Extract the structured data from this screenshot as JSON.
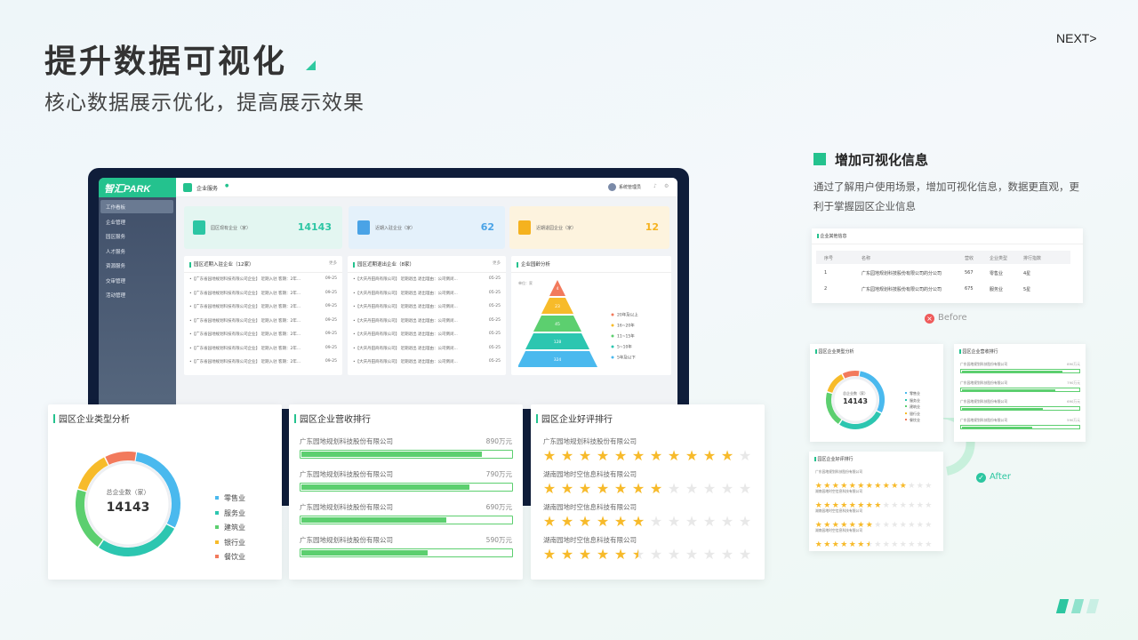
{
  "page": {
    "title": "提升数据可视化",
    "subtitle": "核心数据展示优化，提高展示效果",
    "next": "NEXT>"
  },
  "laptop": {
    "logo": "智汇PARK",
    "tab": "企业服务",
    "user": "系统管理员",
    "nav": [
      {
        "label": "工作看板",
        "active": true
      },
      {
        "label": "企业管理"
      },
      {
        "label": "园区服务"
      },
      {
        "label": "人才服务"
      },
      {
        "label": "资源服务"
      },
      {
        "label": "交审管理"
      },
      {
        "label": "活动管理"
      }
    ],
    "stats": [
      {
        "label": "园区现有企业（家）",
        "value": "14143",
        "color": "#2cc6a4",
        "bg": "#e3f6f1"
      },
      {
        "label": "近期入驻企业（家）",
        "value": "62",
        "color": "#4aa3e6",
        "bg": "#e4f1fb"
      },
      {
        "label": "近期退园企业（家）",
        "value": "12",
        "color": "#f5b21f",
        "bg": "#fdf3de"
      }
    ],
    "panel_in": {
      "title": "园区近期入驻企业（12家）",
      "more": "更多",
      "rows": [
        {
          "text": "•【广东省园地规划科技有限公司企业】 近期入驻 客期：2年...",
          "date": "09-25"
        },
        {
          "text": "•【广东省园地规划科技有限公司企业】 近期入驻 客期：2年...",
          "date": "09-25"
        },
        {
          "text": "•【广东省园地规划科技有限公司企业】 近期入驻 客期：2年...",
          "date": "09-25"
        },
        {
          "text": "•【广东省园地规划科技有限公司企业】 近期入驻 客期：2年...",
          "date": "09-25"
        },
        {
          "text": "•【广东省园地规划科技有限公司企业】 近期入驻 客期：2年...",
          "date": "09-25"
        },
        {
          "text": "•【广东省园地规划科技有限公司企业】 近期入驻 客期：2年...",
          "date": "09-25"
        },
        {
          "text": "•【广东省园地规划科技有限公司企业】 近期入驻 客期：2年...",
          "date": "09-25"
        }
      ]
    },
    "panel_out": {
      "title": "园区近期退出企业（8家）",
      "more": "更多",
      "rows": [
        {
          "text": "•【大庆丹田商有限公司】 近期退出 退出理由：公司倒闭...",
          "date": "05-25"
        },
        {
          "text": "•【大庆丹田商有限公司】 近期退出 退出理由：公司倒闭...",
          "date": "05-25"
        },
        {
          "text": "•【大庆丹田商有限公司】 近期退出 退出理由：公司倒闭...",
          "date": "05-25"
        },
        {
          "text": "•【大庆丹田商有限公司】 近期退出 退出理由：公司倒闭...",
          "date": "05-25"
        },
        {
          "text": "•【大庆丹田商有限公司】 近期退出 退出理由：公司倒闭...",
          "date": "05-25"
        },
        {
          "text": "•【大庆丹田商有限公司】 近期退出 退出理由：公司倒闭...",
          "date": "05-25"
        },
        {
          "text": "•【大庆丹田商有限公司】 近期退出 退出理由：公司倒闭...",
          "date": "05-25"
        }
      ]
    },
    "panel_age": {
      "title": "企业园龄分析",
      "unit": "单位：家",
      "levels": [
        {
          "label": "20年及以上",
          "value": "4",
          "color": "#f27a5c"
        },
        {
          "label": "16~20年",
          "value": "23",
          "color": "#f7bb2a"
        },
        {
          "label": "11~15年",
          "value": "45",
          "color": "#5ccf6f"
        },
        {
          "label": "5~10年",
          "value": "128",
          "color": "#2cc6b0"
        },
        {
          "label": "5年及以下",
          "value": "324",
          "color": "#4ab9ee"
        }
      ]
    }
  },
  "type_card": {
    "title": "园区企业类型分析",
    "center_label": "总企业数（家）",
    "center_value": "14143",
    "legend": [
      {
        "label": "零售业",
        "color": "#4ab9ee"
      },
      {
        "label": "服务业",
        "color": "#2cc6b0"
      },
      {
        "label": "建筑业",
        "color": "#5ccf6f"
      },
      {
        "label": "银行业",
        "color": "#f7bb2a"
      },
      {
        "label": "餐饮业",
        "color": "#f27a5c"
      }
    ]
  },
  "revenue_card": {
    "title": "园区企业营收排行",
    "items": [
      {
        "name": "广东园地规划科技股份有限公司",
        "value": "890万元",
        "fraction": 0.86
      },
      {
        "name": "广东园地规划科技股份有限公司",
        "value": "790万元",
        "fraction": 0.8
      },
      {
        "name": "广东园地规划科技股份有限公司",
        "value": "690万元",
        "fraction": 0.69
      },
      {
        "name": "广东园地规划科技股份有限公司",
        "value": "590万元",
        "fraction": 0.6
      }
    ]
  },
  "rating_card": {
    "title": "园区企业好评排行",
    "items": [
      {
        "name": "广东园地规划科技股份有限公司",
        "stars": 11
      },
      {
        "name": "湖南园地时空信息科技有限公司",
        "stars": 7
      },
      {
        "name": "湖南园地时空信息科技有限公司",
        "stars": 6
      },
      {
        "name": "湖南园地时空信息科技有限公司",
        "stars": 5.5
      }
    ],
    "max_stars": 12
  },
  "right_panel": {
    "heading": "增加可视化信息",
    "description": "通过了解用户使用场景，增加可视化信息，数据更直观，更利于掌握园区企业信息",
    "before_label": "Before",
    "after_label": "After",
    "before_table": {
      "title": "企业其他信息",
      "headers": [
        "序号",
        "名称",
        "营收",
        "企业类型",
        "排行指数"
      ],
      "rows": [
        [
          "1",
          "广东园地规划科技股份有限公司的分公司",
          "567",
          "零售业",
          "4星"
        ],
        [
          "2",
          "广东园地规划科技股份有限公司的分公司",
          "675",
          "服务业",
          "5星"
        ]
      ]
    },
    "mini_type": {
      "title": "园区企业类型分析",
      "center_label": "总企业数（家）",
      "center_value": "14143"
    },
    "mini_revenue": {
      "title": "园区企业营收排行",
      "items": [
        {
          "name": "广东园地规划科技股份有限公司",
          "value": "890万元",
          "fraction": 0.86
        },
        {
          "name": "广东园地规划科技股份有限公司",
          "value": "790万元",
          "fraction": 0.8
        },
        {
          "name": "广东园地规划科技股份有限公司",
          "value": "690万元",
          "fraction": 0.69
        },
        {
          "name": "广东园地规划科技股份有限公司",
          "value": "590万元",
          "fraction": 0.6
        }
      ]
    },
    "mini_rating": {
      "title": "园区企业好评排行",
      "items": [
        {
          "name": "广东园地规划科技股份有限公司",
          "stars": 11
        },
        {
          "name": "湖南园地时空信息科技有限公司",
          "stars": 8
        },
        {
          "name": "湖南园地时空信息科技有限公司",
          "stars": 7
        },
        {
          "name": "湖南园地时空信息科技有限公司",
          "stars": 6.5
        }
      ]
    }
  }
}
